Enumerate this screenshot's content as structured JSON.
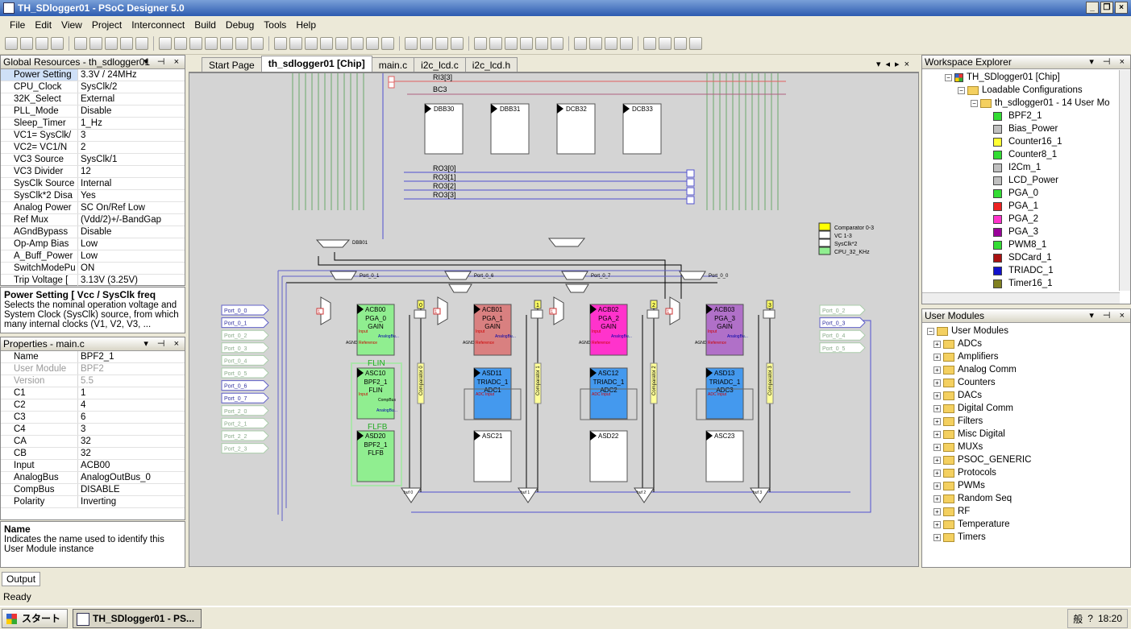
{
  "window": {
    "title": "TH_SDlogger01 - PSoC Designer 5.0"
  },
  "menu": [
    "File",
    "Edit",
    "View",
    "Project",
    "Interconnect",
    "Build",
    "Debug",
    "Tools",
    "Help"
  ],
  "global_resources": {
    "title": "Global Resources - th_sdlogger01",
    "rows": [
      {
        "k": "Power Setting",
        "v": "3.3V / 24MHz"
      },
      {
        "k": "CPU_Clock",
        "v": "SysClk/2"
      },
      {
        "k": "32K_Select",
        "v": "External"
      },
      {
        "k": "PLL_Mode",
        "v": "Disable"
      },
      {
        "k": "Sleep_Timer",
        "v": "1_Hz"
      },
      {
        "k": "VC1= SysClk/",
        "v": "3"
      },
      {
        "k": "VC2= VC1/N",
        "v": "2"
      },
      {
        "k": "VC3 Source",
        "v": "SysClk/1"
      },
      {
        "k": "VC3 Divider",
        "v": "12"
      },
      {
        "k": "SysClk Source",
        "v": "Internal"
      },
      {
        "k": "SysClk*2 Disa",
        "v": "Yes"
      },
      {
        "k": "Analog Power",
        "v": "SC On/Ref Low"
      },
      {
        "k": "Ref Mux",
        "v": "(Vdd/2)+/-BandGap"
      },
      {
        "k": "AGndBypass",
        "v": "Disable"
      },
      {
        "k": "Op-Amp Bias",
        "v": "Low"
      },
      {
        "k": "A_Buff_Power",
        "v": "Low"
      },
      {
        "k": "SwitchModePu",
        "v": "ON"
      },
      {
        "k": "Trip Voltage [",
        "v": "3.13V (3.25V)"
      }
    ],
    "desc_title": "Power Setting [ Vcc / SysClk freq",
    "desc_text": "Selects the nominal operation voltage and System Clock (SysClk) source, from which many internal clocks (V1, V2, V3, ..."
  },
  "properties": {
    "title": "Properties - main.c",
    "rows": [
      {
        "k": "Name",
        "v": "BPF2_1"
      },
      {
        "k": "User Module",
        "v": "BPF2"
      },
      {
        "k": "Version",
        "v": "5.5"
      },
      {
        "k": "C1",
        "v": "1"
      },
      {
        "k": "C2",
        "v": "4"
      },
      {
        "k": "C3",
        "v": "6"
      },
      {
        "k": "C4",
        "v": "3"
      },
      {
        "k": "CA",
        "v": "32"
      },
      {
        "k": "CB",
        "v": "32"
      },
      {
        "k": "Input",
        "v": "ACB00"
      },
      {
        "k": "AnalogBus",
        "v": "AnalogOutBus_0"
      },
      {
        "k": "CompBus",
        "v": "DISABLE"
      },
      {
        "k": "Polarity",
        "v": "Inverting"
      }
    ],
    "desc_title": "Name",
    "desc_text": "Indicates the name used to identify this User Module instance"
  },
  "tabs": [
    "Start Page",
    "th_sdlogger01 [Chip]",
    "main.c",
    "i2c_lcd.c",
    "i2c_lcd.h"
  ],
  "chip": {
    "row_labels": {
      "ri3": "RI3[3]",
      "bc3": "BC3",
      "ro": [
        "RO3[0]",
        "RO3[1]",
        "RO3[2]",
        "RO3[3]"
      ]
    },
    "digital_blocks": [
      "DBB30",
      "DBB31",
      "DCB32",
      "DCB33"
    ],
    "dbb01": "DBB01",
    "legend": [
      "Comparator 0-3",
      "VC 1-3",
      "SysClk*2",
      "CPU_32_KHz"
    ],
    "legend_colors": [
      "#ffff00",
      "#ffffff",
      "#ffffff",
      "#90ee90"
    ],
    "ports_left": [
      "Port_0_0",
      "Port_0_1",
      "Port_0_2",
      "Port_0_3",
      "Port_0_4",
      "Port_0_5",
      "Port_0_6",
      "Port_0_7",
      "Port_2_0",
      "Port_2_1",
      "Port_2_2",
      "Port_2_3"
    ],
    "ports_right": [
      "Port_0_2",
      "Port_0_3",
      "Port_0_4",
      "Port_0_5"
    ],
    "mux_labels": [
      "Port_0_1",
      "Port_0_6",
      "Port_0_7",
      "Port_0_0"
    ],
    "nums": [
      "0",
      "1",
      "2",
      "3"
    ],
    "comparators": [
      "Comparator 0",
      "Comparator 1",
      "Comparator 2",
      "Comparator 3"
    ],
    "bufs": [
      "buf 0",
      "buf 1",
      "buf 2",
      "buf 3"
    ],
    "acb": [
      {
        "id": "ACB00",
        "name": "PGA_0",
        "sub": "GAIN",
        "color": "#90ee90"
      },
      {
        "id": "ACB01",
        "name": "PGA_1",
        "sub": "GAIN",
        "color": "#d98080"
      },
      {
        "id": "ACB02",
        "name": "PGA_2",
        "sub": "GAIN",
        "color": "#ff33cc"
      },
      {
        "id": "ACB03",
        "name": "PGA_3",
        "sub": "GAIN",
        "color": "#b070c8"
      }
    ],
    "asc_row1": [
      {
        "id": "ASC10",
        "name": "BPF2_1",
        "sub": "FLIN",
        "color": "#90ee90"
      },
      {
        "id": "ASD11",
        "name": "TRIADC_1",
        "sub": "ADC1",
        "color": "#4499ee"
      },
      {
        "id": "ASC12",
        "name": "TRIADC_1",
        "sub": "ADC2",
        "color": "#4499ee"
      },
      {
        "id": "ASD13",
        "name": "TRIADC_1",
        "sub": "ADC3",
        "color": "#4499ee"
      }
    ],
    "asc_row2": [
      {
        "id": "ASD20",
        "name": "BPF2_1",
        "sub": "FLFB",
        "color": "#90ee90"
      },
      {
        "id": "ASC21",
        "name": "",
        "sub": "",
        "color": "#ffffff"
      },
      {
        "id": "ASD22",
        "name": "",
        "sub": "",
        "color": "#ffffff"
      },
      {
        "id": "ASC23",
        "name": "",
        "sub": "",
        "color": "#ffffff"
      }
    ],
    "flin": "FLIN",
    "flfb": "FLFB",
    "pin_labels": {
      "input": "Input",
      "agnd": "AGND",
      "reference": "Reference",
      "analogbus": "AnalogBu...",
      "compbus": "CompBus",
      "adcinput": "ADC Input"
    }
  },
  "workspace": {
    "title": "Workspace Explorer",
    "root": "TH_SDlogger01 [Chip]",
    "loadable": "Loadable Configurations",
    "config": "th_sdlogger01 - 14 User Mo",
    "modules": [
      {
        "name": "BPF2_1",
        "color": "#33dd33"
      },
      {
        "name": "Bias_Power",
        "color": "#c0c0c0"
      },
      {
        "name": "Counter16_1",
        "color": "#ffff33"
      },
      {
        "name": "Counter8_1",
        "color": "#33dd33"
      },
      {
        "name": "I2Cm_1",
        "color": "#c0c0c0"
      },
      {
        "name": "LCD_Power",
        "color": "#c0c0c0"
      },
      {
        "name": "PGA_0",
        "color": "#33dd33"
      },
      {
        "name": "PGA_1",
        "color": "#ee2222"
      },
      {
        "name": "PGA_2",
        "color": "#ff33cc"
      },
      {
        "name": "PGA_3",
        "color": "#990099"
      },
      {
        "name": "PWM8_1",
        "color": "#33dd33"
      },
      {
        "name": "SDCard_1",
        "color": "#aa1111"
      },
      {
        "name": "TRIADC_1",
        "color": "#1111cc"
      },
      {
        "name": "Timer16_1",
        "color": "#808020"
      }
    ]
  },
  "user_modules": {
    "title": "User Modules",
    "root": "User Modules",
    "items": [
      "ADCs",
      "Amplifiers",
      "Analog Comm",
      "Counters",
      "DACs",
      "Digital Comm",
      "Filters",
      "Misc Digital",
      "MUXs",
      "PSOC_GENERIC",
      "Protocols",
      "PWMs",
      "Random Seq",
      "RF",
      "Temperature",
      "Timers"
    ]
  },
  "output_tab": "Output",
  "status": "Ready",
  "taskbar": {
    "start": "スタート",
    "task": "TH_SDlogger01 - PS...",
    "clock": "18:20",
    "tray": "般"
  }
}
